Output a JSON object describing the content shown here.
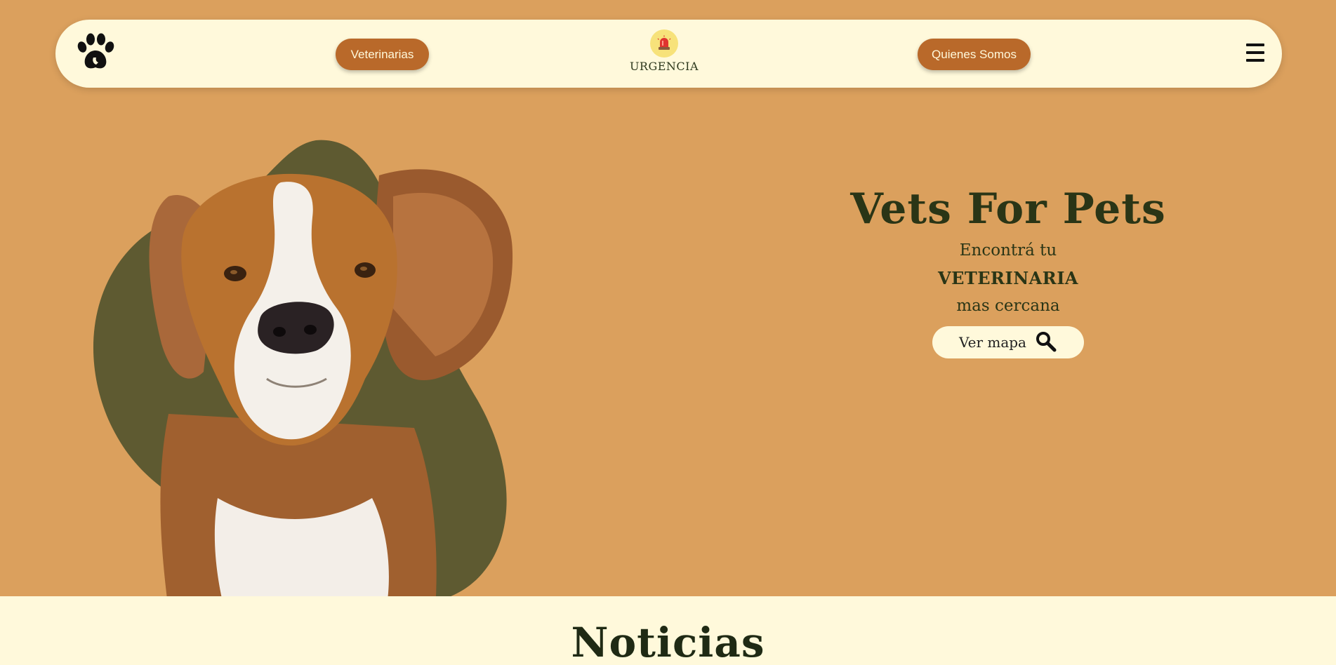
{
  "nav": {
    "logo_icon": "paw-logo-icon",
    "vets_label": "Veterinarias",
    "urgency_icon": "siren-icon",
    "urgency_label": "URGENCIA",
    "about_label": "Quienes Somos",
    "menu_icon": "hamburger-menu-icon"
  },
  "hero": {
    "title": "Vets For Pets",
    "line1": "Encontrá tu",
    "line2": "VETERINARIA",
    "line3": "mas cercana",
    "map_button_label": "Ver mapa",
    "map_button_icon": "search-icon",
    "image": "beagle-dog-photo"
  },
  "news": {
    "title": "Noticias"
  },
  "colors": {
    "background": "#DBA05D",
    "cream": "#FFF9DB",
    "button": "#B9692A",
    "blob": "#5E5A31",
    "text_dark": "#2A3516"
  }
}
